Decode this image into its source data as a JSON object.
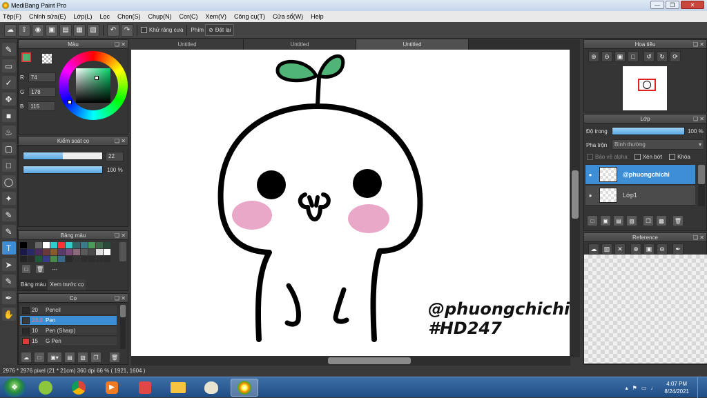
{
  "window": {
    "title": "MediBang Paint Pro"
  },
  "menu": [
    "Tệp(F)",
    "Chỉnh sửa(E)",
    "Lớp(L)",
    "Lọc",
    "Chọn(S)",
    "Chụp(N)",
    "Cor(C)",
    "Xem(V)",
    "Công cụ(T)",
    "Cửa sổ(W)",
    "Help"
  ],
  "toolbar": {
    "antialias_label": "Khử răng cưa",
    "keys_label": "Phím",
    "reset_label": "Đặt lại"
  },
  "tabs": [
    "Untitled",
    "Untitled",
    "Untitled"
  ],
  "color_panel": {
    "title": "Màu",
    "r_label": "R",
    "g_label": "G",
    "b_label": "B",
    "r": "74",
    "g": "178",
    "b": "115",
    "primary_color": "#4ab273",
    "secondary_color": "#ffffff"
  },
  "brush_control": {
    "title": "Kiểm soát cọ",
    "size_value": "22",
    "size_fraction": 0.5,
    "opacity_value": "100 %",
    "opacity_fraction": 1.0
  },
  "palette_panel": {
    "title": "Bảng màu",
    "separator_text": "---",
    "tab_palette": "Bảng màu",
    "tab_preview": "Xem trước cọ",
    "colors": [
      "#000000",
      "#333333",
      "#666666",
      "#ffffff",
      "#33cccc",
      "#ff3333",
      "#33cccc",
      "#336666",
      "#3a7a8a",
      "#4a9a5a",
      "#3a6a4a",
      "#2a4a3a",
      "#1a1a4a",
      "#2a2a6a",
      "#4a2a5a",
      "#6a3a3a",
      "#8a5a2a",
      "#5a3a6a",
      "#7a4a7a",
      "#8a6a7a",
      "#5a5a5a",
      "#4a4a4a",
      "#e0e0e0",
      "#ffffff",
      "#222222",
      "#2a2a2a",
      "#1e5a3a",
      "#3a3a8a",
      "#4a8a4a",
      "#3a6a8a",
      "#2a2a2a",
      "#333333",
      "#2e2e2e",
      "#2e2e2e",
      "#2e2e2e",
      "#2e2e2e"
    ]
  },
  "brush_panel": {
    "title": "Cọ",
    "items": [
      {
        "size": "20",
        "name": "Pencil",
        "color": "#2a2a2a"
      },
      {
        "size": "23.0",
        "name": "Pen",
        "color": "#3a3a3a"
      },
      {
        "size": "10",
        "name": "Pen (Sharp)",
        "color": "#2a2a2a"
      },
      {
        "size": "15",
        "name": "G Pen",
        "color": "#e03a3a"
      }
    ]
  },
  "canvas": {
    "watermark_line1": "@phuongchichi",
    "watermark_line2": "#HD247"
  },
  "status": {
    "text": "2976 * 2976 pixel   (21 * 21cm)   360 dpi   66 %   ( 1921, 1604 )"
  },
  "navigator": {
    "title": "Hoa tiêu"
  },
  "layer_panel": {
    "title": "Lớp",
    "opacity_label": "Độ trong",
    "opacity_value": "100 %",
    "opacity_fraction": 1.0,
    "blend_label": "Pha trộn",
    "blend_value": "Bình thường",
    "protect_alpha": "Bảo vệ alpha",
    "clipping": "Xén bớt",
    "lock": "Khóa",
    "layers": [
      {
        "name": "@phuongchichi",
        "selected": true
      },
      {
        "name": "Lớp1",
        "selected": false
      }
    ]
  },
  "reference_panel": {
    "title": "Reference"
  },
  "taskbar": {
    "time": "4:07 PM",
    "date": "8/24/2021"
  }
}
